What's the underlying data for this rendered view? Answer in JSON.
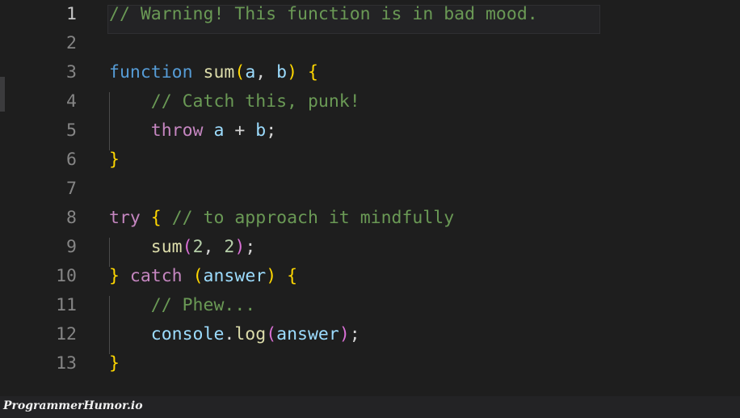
{
  "editor": {
    "language": "javascript",
    "background_color": "#1e1e1e",
    "active_line": 1,
    "total_lines": 13,
    "gutter": {
      "line_numbers": [
        "1",
        "2",
        "3",
        "4",
        "5",
        "6",
        "7",
        "8",
        "9",
        "10",
        "11",
        "12",
        "13"
      ],
      "number_color": "#858585",
      "active_number_color": "#c6c6c6"
    },
    "theme_colors": {
      "comment": "#6a9955",
      "keyword": "#569cd6",
      "control_keyword": "#c586c0",
      "function_name": "#dcdcaa",
      "variable": "#9cdcfe",
      "number": "#b5cea8",
      "punctuation": "#d4d4d4",
      "bracket_gold": "#ffd700",
      "bracket_pink": "#da70d6",
      "active_line_background": "#232325",
      "indent_guide": "#4a4a4a"
    },
    "lines": [
      {
        "number": "1",
        "plain": "// Warning! This function is in bad mood.",
        "tokens": [
          {
            "text": "// Warning! This function is in bad mood.",
            "type": "comment"
          }
        ]
      },
      {
        "number": "2",
        "plain": "",
        "tokens": []
      },
      {
        "number": "3",
        "plain": "function sum(a, b) {",
        "tokens": [
          {
            "text": "function",
            "type": "keyword"
          },
          {
            "text": " ",
            "type": "punct"
          },
          {
            "text": "sum",
            "type": "func"
          },
          {
            "text": "(",
            "type": "bracket_gold"
          },
          {
            "text": "a",
            "type": "var"
          },
          {
            "text": ", ",
            "type": "punct"
          },
          {
            "text": "b",
            "type": "var"
          },
          {
            "text": ")",
            "type": "bracket_gold"
          },
          {
            "text": " ",
            "type": "punct"
          },
          {
            "text": "{",
            "type": "bracket_gold"
          }
        ]
      },
      {
        "number": "4",
        "plain": "    // Catch this, punk!",
        "tokens": [
          {
            "text": "    ",
            "type": "punct"
          },
          {
            "text": "// Catch this, punk!",
            "type": "comment"
          }
        ]
      },
      {
        "number": "5",
        "plain": "    throw a + b;",
        "tokens": [
          {
            "text": "    ",
            "type": "punct"
          },
          {
            "text": "throw",
            "type": "control"
          },
          {
            "text": " ",
            "type": "punct"
          },
          {
            "text": "a",
            "type": "var"
          },
          {
            "text": " + ",
            "type": "punct"
          },
          {
            "text": "b",
            "type": "var"
          },
          {
            "text": ";",
            "type": "punct"
          }
        ]
      },
      {
        "number": "6",
        "plain": "}",
        "tokens": [
          {
            "text": "}",
            "type": "bracket_gold"
          }
        ]
      },
      {
        "number": "7",
        "plain": "",
        "tokens": []
      },
      {
        "number": "8",
        "plain": "try { // to approach it mindfully",
        "tokens": [
          {
            "text": "try",
            "type": "control"
          },
          {
            "text": " ",
            "type": "punct"
          },
          {
            "text": "{",
            "type": "bracket_gold"
          },
          {
            "text": " ",
            "type": "punct"
          },
          {
            "text": "// to approach it mindfully",
            "type": "comment"
          }
        ]
      },
      {
        "number": "9",
        "plain": "    sum(2, 2);",
        "tokens": [
          {
            "text": "    ",
            "type": "punct"
          },
          {
            "text": "sum",
            "type": "func"
          },
          {
            "text": "(",
            "type": "bracket_pink"
          },
          {
            "text": "2",
            "type": "num"
          },
          {
            "text": ", ",
            "type": "punct"
          },
          {
            "text": "2",
            "type": "num"
          },
          {
            "text": ")",
            "type": "bracket_pink"
          },
          {
            "text": ";",
            "type": "punct"
          }
        ]
      },
      {
        "number": "10",
        "plain": "} catch (answer) {",
        "tokens": [
          {
            "text": "}",
            "type": "bracket_gold"
          },
          {
            "text": " ",
            "type": "punct"
          },
          {
            "text": "catch",
            "type": "control"
          },
          {
            "text": " ",
            "type": "punct"
          },
          {
            "text": "(",
            "type": "bracket_gold"
          },
          {
            "text": "answer",
            "type": "var"
          },
          {
            "text": ")",
            "type": "bracket_gold"
          },
          {
            "text": " ",
            "type": "punct"
          },
          {
            "text": "{",
            "type": "bracket_gold"
          }
        ]
      },
      {
        "number": "11",
        "plain": "    // Phew...",
        "tokens": [
          {
            "text": "    ",
            "type": "punct"
          },
          {
            "text": "// Phew...",
            "type": "comment"
          }
        ]
      },
      {
        "number": "12",
        "plain": "    console.log(answer);",
        "tokens": [
          {
            "text": "    ",
            "type": "punct"
          },
          {
            "text": "console",
            "type": "var"
          },
          {
            "text": ".",
            "type": "punct"
          },
          {
            "text": "log",
            "type": "func"
          },
          {
            "text": "(",
            "type": "bracket_pink"
          },
          {
            "text": "answer",
            "type": "var"
          },
          {
            "text": ")",
            "type": "bracket_pink"
          },
          {
            "text": ";",
            "type": "punct"
          }
        ]
      },
      {
        "number": "13",
        "plain": "}",
        "tokens": [
          {
            "text": "}",
            "type": "bracket_gold"
          }
        ]
      }
    ]
  },
  "watermark": {
    "text": "ProgrammerHumor.io"
  }
}
